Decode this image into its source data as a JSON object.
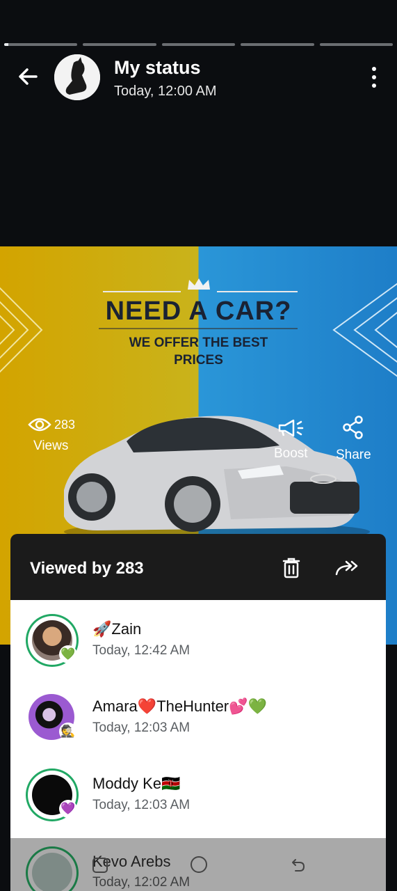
{
  "header": {
    "title": "My status",
    "subtitle": "Today, 12:00 AM"
  },
  "progress": {
    "segments": 5,
    "active_fill_fraction": 0.06
  },
  "status_image": {
    "headline": "NEED A CAR?",
    "tagline_line1": "WE OFFER THE BEST",
    "tagline_line2": "PRICES"
  },
  "actions": {
    "views_count": "283",
    "views_label": "Views",
    "boost_label": "Boost",
    "share_label": "Share"
  },
  "sheet": {
    "title": "Viewed by 283",
    "viewers": [
      {
        "name": "🚀Zain",
        "time": "Today, 12:42 AM",
        "badge": "💚"
      },
      {
        "name": "Amara❤️TheHunter💕💚",
        "time": "Today, 12:03 AM",
        "badge": "🕵️"
      },
      {
        "name": "Moddy Ke🇰🇪",
        "time": "Today, 12:03 AM",
        "badge": "💜"
      },
      {
        "name": "Kevo Arebs",
        "time": "Today, 12:02 AM",
        "badge": "🧑"
      }
    ]
  },
  "colors": {
    "ring_green": "#21a864",
    "sheet_header": "#1b1b1b",
    "background": "#0b0d10"
  }
}
